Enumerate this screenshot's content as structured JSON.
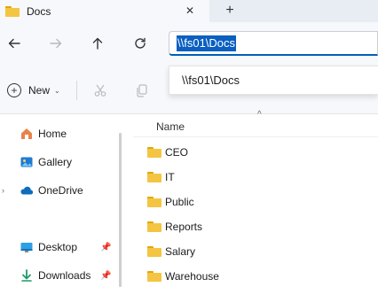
{
  "tab": {
    "title": "Docs",
    "icon": "folder-icon",
    "close_glyph": "✕",
    "new_tab_glyph": "+"
  },
  "nav": {
    "back_icon": "arrow-left-icon",
    "forward_icon": "arrow-right-icon",
    "up_icon": "arrow-up-icon",
    "refresh_icon": "refresh-icon",
    "address_value": "\\\\fs01\\Docs",
    "suggestion": "\\\\fs01\\Docs"
  },
  "toolbar": {
    "new_label": "New",
    "new_chevron": "⌄",
    "plus_glyph": "+"
  },
  "sidebar": {
    "items": [
      {
        "label": "Home",
        "icon": "home-icon"
      },
      {
        "label": "Gallery",
        "icon": "gallery-icon"
      },
      {
        "label": "OneDrive",
        "icon": "cloud-icon",
        "expander": "›"
      },
      {
        "label": "Desktop",
        "icon": "desktop-icon",
        "pin": "📌"
      },
      {
        "label": "Downloads",
        "icon": "download-icon",
        "pin": "📌"
      }
    ]
  },
  "main": {
    "column_header": "Name",
    "sort_caret": "^",
    "rows": [
      {
        "label": "CEO"
      },
      {
        "label": "IT"
      },
      {
        "label": "Public"
      },
      {
        "label": "Reports"
      },
      {
        "label": "Salary"
      },
      {
        "label": "Warehouse"
      }
    ]
  },
  "colors": {
    "accent": "#005fb8",
    "selection": "#0a5fc1",
    "folder": "#f4c542",
    "chrome": "#f6f8fb"
  }
}
